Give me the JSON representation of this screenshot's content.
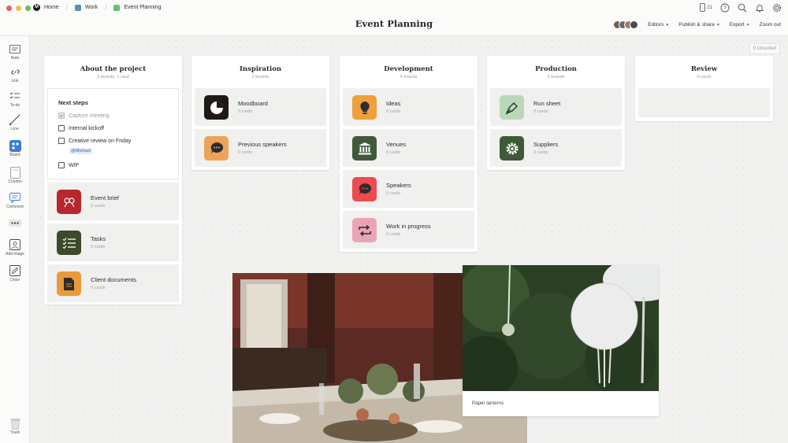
{
  "breadcrumbs": {
    "home": "Home",
    "work": "Work",
    "current": "Event Planning"
  },
  "header": {
    "title": "Event Planning",
    "device_count": "21",
    "editors_label": "Editors",
    "publish_label": "Publish & share",
    "export_label": "Export",
    "zoom_label": "Zoom out"
  },
  "toolbar": {
    "note": "Note",
    "link": "Link",
    "todo": "To-do",
    "line": "Line",
    "board": "Board",
    "column": "Column",
    "comment": "Comment",
    "add_image": "Add image",
    "draw": "Draw",
    "trash": "Trash"
  },
  "canvas": {
    "unsorted_count": "0",
    "unsorted_label": "Unsorted"
  },
  "columns": {
    "about": {
      "title": "About the project",
      "subtitle": "3 boards, 1 card",
      "todo": {
        "title": "Next steps",
        "items": [
          {
            "label": "Capture meeting",
            "done": true
          },
          {
            "label": "Internal kickoff",
            "done": false
          },
          {
            "label": "Creative review on Friday",
            "done": false
          },
          {
            "label": "WIP",
            "done": false
          }
        ],
        "mention": "@Michael"
      },
      "cards": [
        {
          "name": "Event brief",
          "count": "0 cards",
          "color": "#b8262e",
          "icon": "people-talking-icon"
        },
        {
          "name": "Tasks",
          "count": "0 cards",
          "color": "#3b4a2a",
          "icon": "checklist-icon"
        },
        {
          "name": "Client documents",
          "count": "0 cards",
          "color": "#e89a3c",
          "icon": "document-icon"
        }
      ]
    },
    "inspiration": {
      "title": "Inspiration",
      "subtitle": "2 boards",
      "cards": [
        {
          "name": "Moodboard",
          "count": "0 cards",
          "color": "#1f1a17",
          "icon": "moodboard-icon"
        },
        {
          "name": "Previous speakers",
          "count": "0 cards",
          "color": "#eea35b",
          "icon": "speech-bubble-icon"
        }
      ]
    },
    "development": {
      "title": "Development",
      "subtitle": "4 boards",
      "cards": [
        {
          "name": "Ideas",
          "count": "0 cards",
          "color": "#f0a03a",
          "icon": "lightbulb-icon"
        },
        {
          "name": "Venues",
          "count": "0 cards",
          "color": "#405a3a",
          "icon": "building-icon"
        },
        {
          "name": "Speakers",
          "count": "0 cards",
          "color": "#ef4a4f",
          "icon": "chat-icon"
        },
        {
          "name": "Work in progress",
          "count": "0 cards",
          "color": "#eaa4b6",
          "icon": "repeat-icon"
        }
      ]
    },
    "production": {
      "title": "Production",
      "subtitle": "2 boards",
      "cards": [
        {
          "name": "Run sheet",
          "count": "0 cards",
          "color": "#b9d9b6",
          "icon": "pen-nib-icon"
        },
        {
          "name": "Suppliers",
          "count": "0 cards",
          "color": "#3f5a36",
          "icon": "gear-icon"
        }
      ]
    },
    "review": {
      "title": "Review",
      "subtitle": "0 cards"
    }
  },
  "photos": {
    "lanterns_caption": "Paper lanterns"
  },
  "colors": {
    "traffic_red": "#ee5f57",
    "traffic_yellow": "#f4bd4f",
    "traffic_green": "#5fc454",
    "work_square": "#5a8fb0",
    "event_square": "#5dc468",
    "board_tool": "#3a7bd5",
    "mention_text": "#2f5fa8"
  }
}
